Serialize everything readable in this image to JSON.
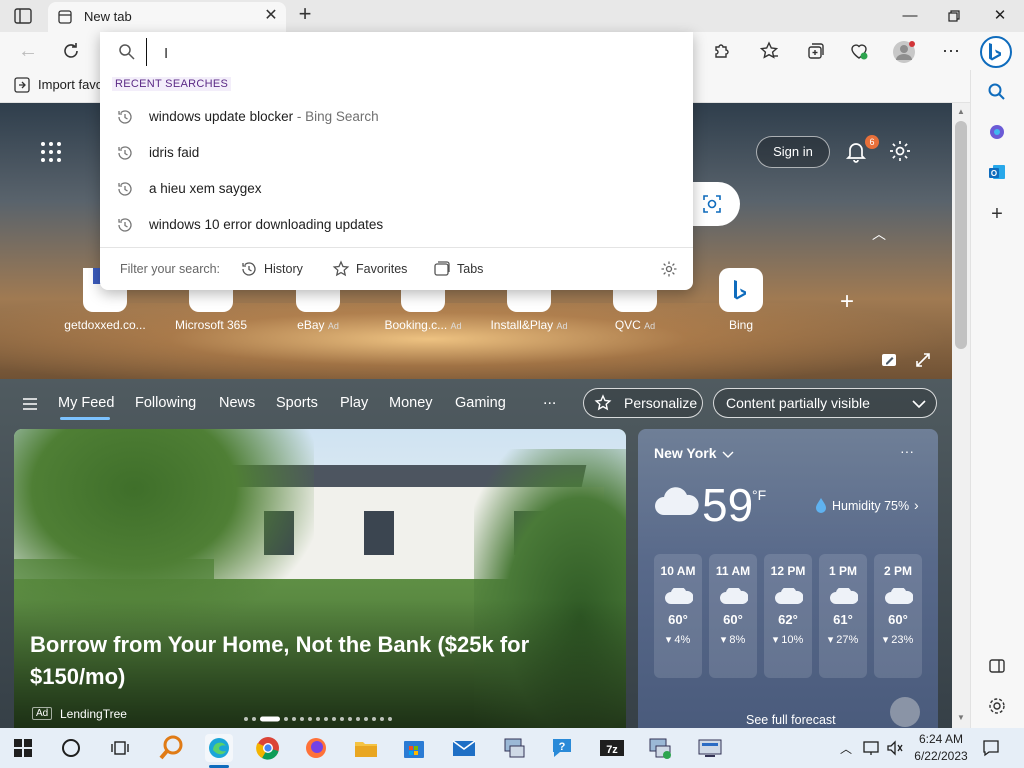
{
  "browser": {
    "tab_title": "New tab",
    "address_value": "",
    "favorites_import_label": "Import favo"
  },
  "search_dropdown": {
    "section_heading": "RECENT SEARCHES",
    "items": [
      {
        "text": "windows update blocker",
        "suffix": " - Bing Search"
      },
      {
        "text": "idris faid",
        "suffix": ""
      },
      {
        "text": "a hieu xem saygex",
        "suffix": ""
      },
      {
        "text": "windows 10 error downloading updates",
        "suffix": ""
      }
    ],
    "filter_label": "Filter your search:",
    "filters": [
      "History",
      "Favorites",
      "Tabs"
    ]
  },
  "newtab": {
    "sign_in_label": "Sign in",
    "notification_count": "6",
    "quick_links": [
      {
        "label": "getdoxxed.co...",
        "ad": ""
      },
      {
        "label": "Microsoft 365",
        "ad": ""
      },
      {
        "label": "eBay",
        "ad": "Ad"
      },
      {
        "label": "Booking.c...",
        "ad": "Ad"
      },
      {
        "label": "Install&Play",
        "ad": "Ad"
      },
      {
        "label": "QVC",
        "ad": "Ad"
      },
      {
        "label": "Bing",
        "ad": ""
      }
    ],
    "nav_tabs": [
      "My Feed",
      "Following",
      "News",
      "Sports",
      "Play",
      "Money",
      "Gaming"
    ],
    "more_label": "...",
    "personalize_label": "Personalize",
    "content_visibility_label": "Content partially visible",
    "hero_headline": "Borrow from Your Home, Not the Bank ($25k for $150/mo)",
    "hero_ad_tag": "Ad",
    "hero_source": "LendingTree"
  },
  "weather": {
    "location": "New York",
    "temperature": "59",
    "unit": "°F",
    "humidity": "Humidity 75%",
    "hourly": [
      {
        "time": "10 AM",
        "temp": "60°",
        "precip": "4%"
      },
      {
        "time": "11 AM",
        "temp": "60°",
        "precip": "8%"
      },
      {
        "time": "12 PM",
        "temp": "62°",
        "precip": "10%"
      },
      {
        "time": "1 PM",
        "temp": "61°",
        "precip": "27%"
      },
      {
        "time": "2 PM",
        "temp": "60°",
        "precip": "23%"
      }
    ],
    "forecast_link": "See full forecast"
  },
  "taskbar": {
    "time": "6:24 AM",
    "date": "6/22/2023"
  },
  "colors": {
    "accent": "#0f6cbd",
    "notification_badge": "#e8703a",
    "taskbar": "#e6eef7"
  }
}
